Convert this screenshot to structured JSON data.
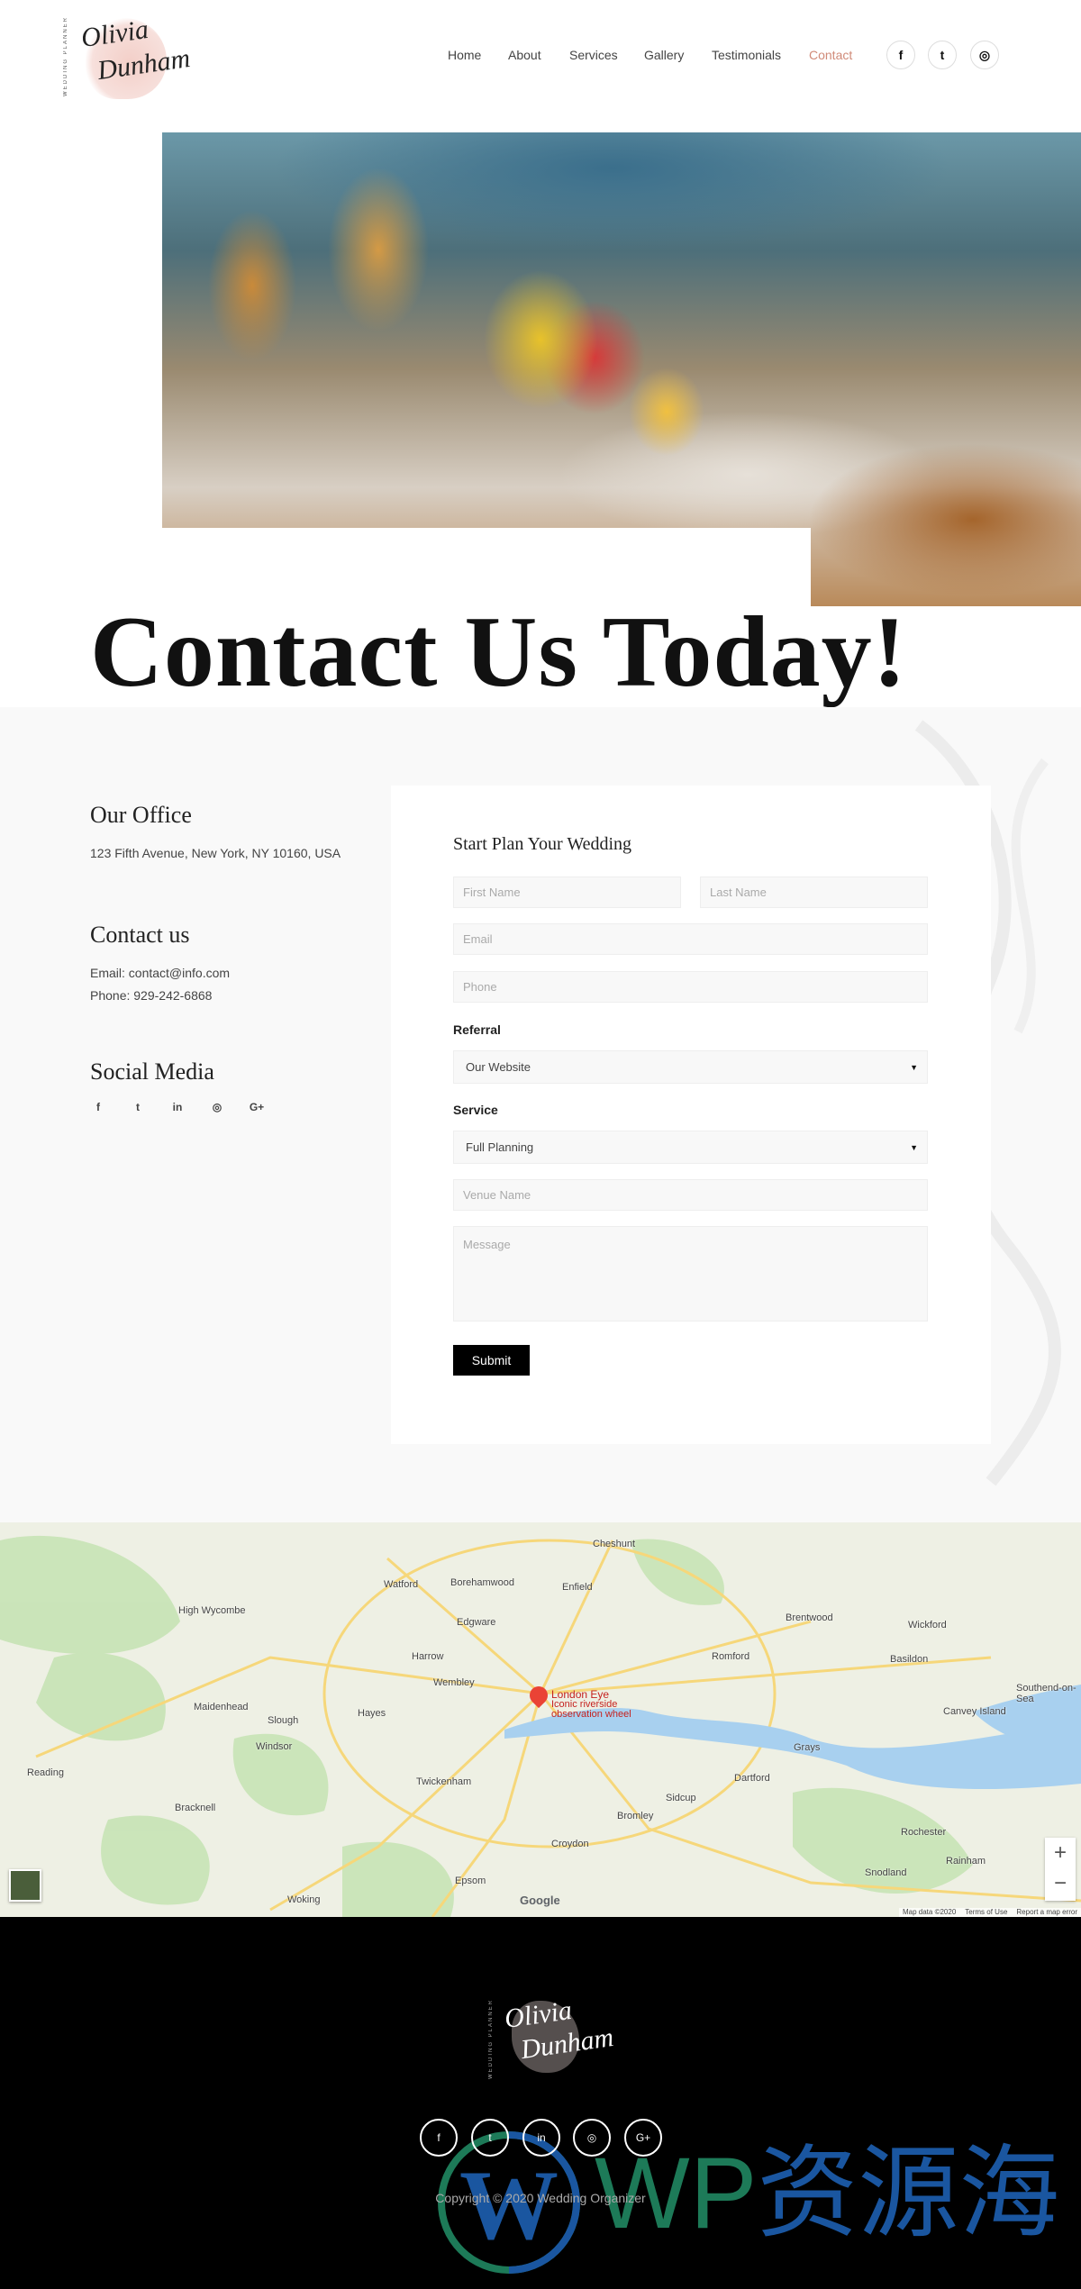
{
  "header": {
    "logo": {
      "script_line1": "Olivia",
      "script_line2": "Dunham",
      "tagline": "WEDDING PLANNER"
    },
    "nav": [
      {
        "label": "Home"
      },
      {
        "label": "About"
      },
      {
        "label": "Services"
      },
      {
        "label": "Gallery"
      },
      {
        "label": "Testimonials"
      },
      {
        "label": "Contact",
        "active": true
      }
    ],
    "social": [
      {
        "icon": "facebook-icon",
        "glyph": "f"
      },
      {
        "icon": "twitter-icon",
        "glyph": "t"
      },
      {
        "icon": "instagram-icon",
        "glyph": "◎"
      }
    ]
  },
  "colors": {
    "accent": "#d08a78",
    "footer_bg": "#000000",
    "section_bg": "#f9f9f9"
  },
  "page_title": "Contact Us Today!",
  "office": {
    "heading": "Our Office",
    "address": "123 Fifth Avenue, New York, NY 10160, USA"
  },
  "contact": {
    "heading": "Contact us",
    "email": "Email: contact@info.com",
    "phone": "Phone: 929-242-6868"
  },
  "social_media": {
    "heading": "Social Media",
    "icons": [
      {
        "icon": "facebook-icon",
        "glyph": "f"
      },
      {
        "icon": "twitter-icon",
        "glyph": "t"
      },
      {
        "icon": "linkedin-icon",
        "glyph": "in"
      },
      {
        "icon": "instagram-icon",
        "glyph": "◎"
      },
      {
        "icon": "google-plus-icon",
        "glyph": "G+"
      }
    ]
  },
  "form": {
    "title": "Start Plan Your Wedding",
    "first_name": {
      "placeholder": "First Name",
      "value": ""
    },
    "last_name": {
      "placeholder": "Last Name",
      "value": ""
    },
    "email": {
      "placeholder": "Email",
      "value": ""
    },
    "phone": {
      "placeholder": "Phone",
      "value": ""
    },
    "referral": {
      "label": "Referral",
      "selected": "Our Website"
    },
    "service": {
      "label": "Service",
      "selected": "Full Planning"
    },
    "venue": {
      "placeholder": "Venue Name",
      "value": ""
    },
    "message": {
      "placeholder": "Message",
      "value": ""
    },
    "submit_label": "Submit"
  },
  "map": {
    "marker": {
      "title": "London Eye",
      "subtitle1": "Iconic riverside",
      "subtitle2": "observation wheel"
    },
    "places": [
      "Watford",
      "Enfield",
      "Harrow",
      "Wembley",
      "Slough",
      "Hayes",
      "Maidenhead",
      "High Wycombe",
      "Reading",
      "Bracknell",
      "Twickenham",
      "Croydon",
      "Bromley",
      "Dartford",
      "Romford",
      "Basildon",
      "Southend-on-Sea",
      "Grays",
      "Epsom",
      "Woking",
      "Edgware",
      "Brentwood",
      "Rochester",
      "Sidcup",
      "Borehamwood",
      "Wickford",
      "Canvey Island",
      "Windsor",
      "Cheshunt",
      "Rainham",
      "Snodland"
    ],
    "zoom_in": "+",
    "zoom_out": "−",
    "google": "Google",
    "attribution": "Map data ©2020",
    "terms": "Terms of Use",
    "report": "Report a map error"
  },
  "footer": {
    "logo": {
      "script_line1": "Olivia",
      "script_line2": "Dunham",
      "tagline": "WEDDING PLANNER"
    },
    "social": [
      {
        "icon": "facebook-icon",
        "glyph": "f"
      },
      {
        "icon": "twitter-icon",
        "glyph": "t"
      },
      {
        "icon": "linkedin-icon",
        "glyph": "in"
      },
      {
        "icon": "instagram-icon",
        "glyph": "◎"
      },
      {
        "icon": "google-plus-icon",
        "glyph": "G+"
      }
    ],
    "copyright": "Copyright © 2020 Wedding Organizer"
  },
  "watermark": {
    "text_latin": "WP",
    "text_cjk": "资源海"
  }
}
